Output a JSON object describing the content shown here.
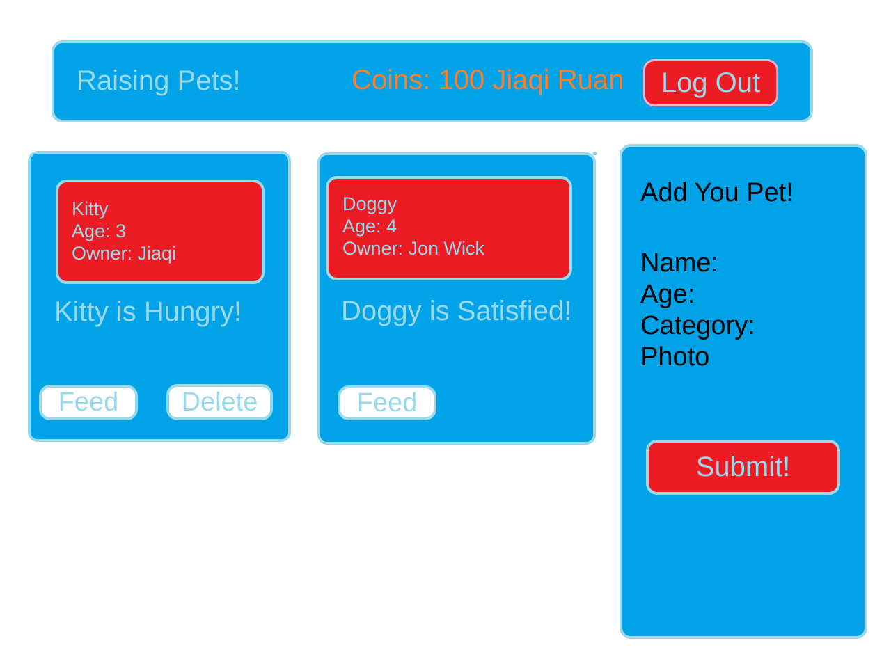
{
  "header": {
    "app_title": "Raising Pets!",
    "user_info": "Coins: 100 Jiaqi Ruan",
    "logout_label": "Log Out"
  },
  "pets": [
    {
      "name_line": "Kitty",
      "age_line": "Age: 3",
      "owner_line": "Owner: Jiaqi",
      "status": "Kitty is Hungry!",
      "feed_label": "Feed",
      "delete_label": "Delete"
    },
    {
      "name_line": "Doggy",
      "age_line": "Age: 4",
      "owner_line": "Owner: Jon Wick",
      "status": "Doggy is Satisfied!",
      "feed_label": "Feed"
    }
  ],
  "form": {
    "title": "Add You Pet!",
    "name_label": "Name:",
    "age_label": "Age:",
    "category_label": "Category:",
    "photo_label": "Photo",
    "submit_label": "Submit!"
  },
  "colors": {
    "panel": "#00a2e8",
    "border": "#99d9ea",
    "accent_red": "#ed1c24",
    "coins_orange": "#ff7f27",
    "logout_border": "#ffaec9"
  }
}
